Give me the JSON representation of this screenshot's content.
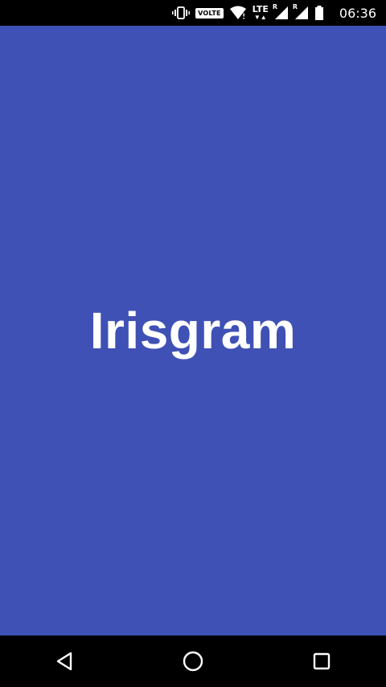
{
  "status_bar": {
    "volte_label": "VOLTE",
    "lte_label": "LTE",
    "roaming_1": "R",
    "roaming_2": "R",
    "time": "06:36",
    "icons": [
      "vibrate-icon",
      "wifi-icon",
      "lte-data-icon",
      "signal-icon",
      "signal-icon",
      "battery-icon"
    ]
  },
  "splash": {
    "app_name": "Irisgram",
    "background_color": "#3f51b5",
    "text_color": "#ffffff"
  },
  "nav_bar": {
    "icons": [
      "back-icon",
      "home-icon",
      "recents-icon"
    ]
  }
}
